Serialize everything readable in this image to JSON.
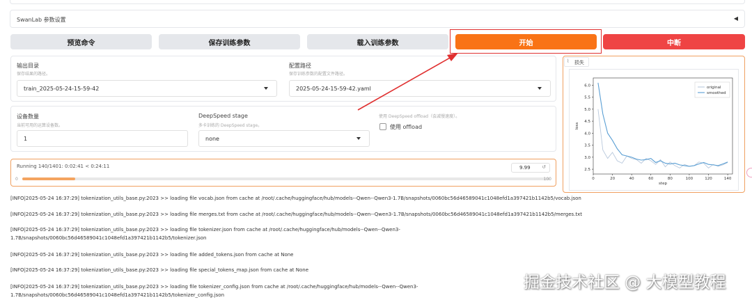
{
  "top_bar": {
    "title": "SwanLab 参数设置",
    "toggle_glyph": "◀"
  },
  "buttons": {
    "preview": "预览命令",
    "save": "保存训练参数",
    "load": "载入训练参数",
    "start": "开始",
    "stop": "中断"
  },
  "output_dir": {
    "label": "输出目录",
    "hint": "保存结果的路径。",
    "value": "train_2025-05-24-15-59-42"
  },
  "config_path": {
    "label": "配置路径",
    "hint": "保存训练参数的配置文件路径。",
    "value": "2025-05-24-15-59-42.yaml"
  },
  "device_count": {
    "label": "设备数量",
    "hint": "当前可用的运算设备数。",
    "value": "1"
  },
  "deepspeed": {
    "label": "DeepSpeed stage",
    "hint": "多卡训练的 DeepSpeed stage。",
    "value": "none"
  },
  "offload": {
    "hint": "使用 DeepSpeed offload（会减慢速度）。",
    "label": "使用 offload",
    "checked": false
  },
  "progress": {
    "status": "Running 140/1401: 0:02:41 < 0:24:11",
    "value": "9.99",
    "min": "0",
    "max": "100",
    "fraction": 0.0999,
    "reset_icon": "reset-icon"
  },
  "chart_tab": {
    "label": "损失",
    "icon": "chart-icon"
  },
  "chart_data": {
    "type": "line",
    "xlabel": "step",
    "ylabel": "loss",
    "xlim": [
      0,
      145
    ],
    "ylim": [
      2.3,
      6.3
    ],
    "x_ticks": [
      "0",
      "20",
      "40",
      "60",
      "80",
      "100",
      "120",
      "140"
    ],
    "y_ticks": [
      "2.5",
      "3.0",
      "3.5",
      "4.0",
      "4.5",
      "5.0",
      "5.5",
      "6.0"
    ],
    "legend_position": "top-right",
    "series": [
      {
        "name": "original",
        "color": "#b8c8dc",
        "x": [
          5,
          10,
          15,
          20,
          25,
          30,
          35,
          40,
          45,
          50,
          55,
          60,
          65,
          70,
          75,
          80,
          85,
          90,
          95,
          100,
          105,
          110,
          115,
          120,
          125,
          130,
          135,
          140
        ],
        "y": [
          5.0,
          3.3,
          2.95,
          3.2,
          2.85,
          2.75,
          3.05,
          2.95,
          2.9,
          2.75,
          2.95,
          2.85,
          2.7,
          2.9,
          2.6,
          2.8,
          2.65,
          2.55,
          2.7,
          2.62,
          2.65,
          2.8,
          2.75,
          2.55,
          2.7,
          2.62,
          2.68,
          2.78
        ]
      },
      {
        "name": "smoothed",
        "color": "#5a9fd4",
        "x": [
          5,
          10,
          15,
          20,
          25,
          30,
          35,
          40,
          45,
          50,
          55,
          60,
          65,
          70,
          75,
          80,
          85,
          90,
          95,
          100,
          105,
          110,
          115,
          120,
          125,
          130,
          135,
          140
        ],
        "y": [
          6.1,
          4.8,
          4.0,
          3.7,
          3.35,
          3.1,
          3.05,
          3.0,
          2.92,
          2.88,
          2.9,
          2.95,
          2.78,
          2.85,
          2.75,
          2.72,
          2.75,
          2.68,
          2.65,
          2.62,
          2.65,
          2.72,
          2.78,
          2.7,
          2.68,
          2.65,
          2.72,
          2.8
        ]
      }
    ]
  },
  "logs": [
    "[INFO|2025-05-24 16:37:29] tokenization_utils_base.py:2023 >> loading file vocab.json from cache at /root/.cache/huggingface/hub/models--Qwen--Qwen3-1.7B/snapshots/0060bc56d46589041c1048efd1a397421b1142b5/vocab.json",
    "[INFO|2025-05-24 16:37:29] tokenization_utils_base.py:2023 >> loading file merges.txt from cache at /root/.cache/huggingface/hub/models--Qwen--Qwen3-1.7B/snapshots/0060bc56d46589041c1048efd1a397421b1142b5/merges.txt",
    "[INFO|2025-05-24 16:37:29] tokenization_utils_base.py:2023 >> loading file tokenizer.json from cache at /root/.cache/huggingface/hub/models--Qwen--Qwen3-",
    "1.7B/snapshots/0060bc56d46589041c1048efd1a397421b1142b5/tokenizer.json",
    "[INFO|2025-05-24 16:37:29] tokenization_utils_base.py:2023 >> loading file added_tokens.json from cache at None",
    "[INFO|2025-05-24 16:37:29] tokenization_utils_base.py:2023 >> loading file special_tokens_map.json from cache at None",
    "[INFO|2025-05-24 16:37:29] tokenization_utils_base.py:2023 >> loading file tokenizer_config.json from cache at /root/.cache/huggingface/hub/models--Qwen--Qwen3-",
    "1.7B/snapshots/0060bc56d46589041c1048efd1a397421b1142b5/tokenizer_config.json"
  ],
  "watermark": "掘金技术社区 @ 大模型教程",
  "colors": {
    "accent": "#f97316",
    "stop": "#ef4444",
    "annotation": "#e03030"
  }
}
